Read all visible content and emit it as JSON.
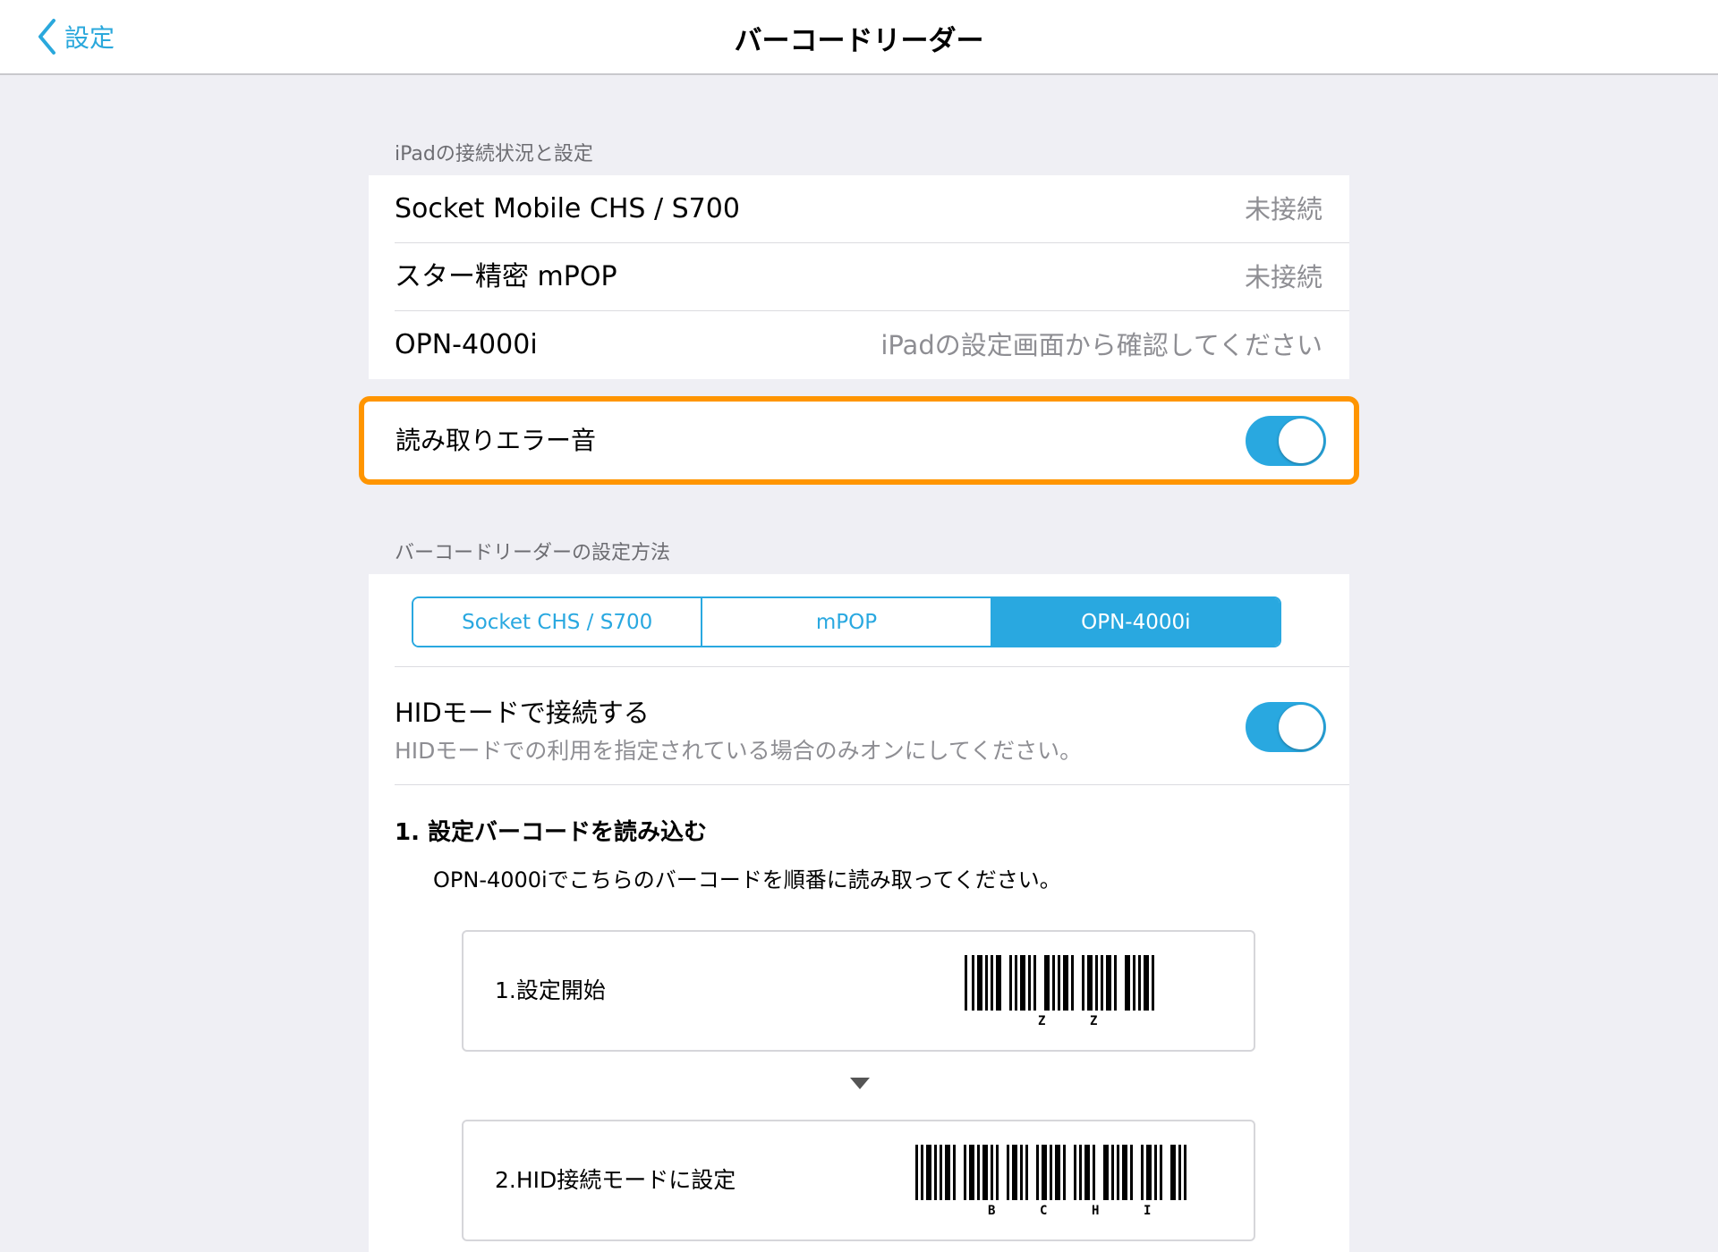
{
  "nav": {
    "back_label": "設定",
    "title": "バーコードリーダー"
  },
  "section1": {
    "header": "iPadの接続状況と設定",
    "rows": [
      {
        "title": "Socket Mobile CHS / S700",
        "value": "未接続"
      },
      {
        "title": "スター精密 mPOP",
        "value": "未接続"
      },
      {
        "title": "OPN-4000i",
        "value": "iPadの設定画面から確認してください"
      }
    ],
    "error_sound": {
      "label": "読み取りエラー音",
      "on": true
    }
  },
  "section2": {
    "header": "バーコードリーダーの設定方法",
    "segments": [
      "Socket CHS / S700",
      "mPOP",
      "OPN-4000i"
    ],
    "selected_segment": "OPN-4000i",
    "hid": {
      "title": "HIDモードで接続する",
      "subtitle": "HIDモードでの利用を指定されている場合のみオンにしてください。",
      "on": true
    },
    "step1": {
      "heading": "1. 設定バーコードを読み込む",
      "description": "OPN-4000iでこちらのバーコードを順番に読み取ってください。"
    },
    "cards": [
      {
        "label": "1.設定開始",
        "barcode_text": [
          "Z",
          "Z"
        ]
      },
      {
        "label": "2.HID接続モードに設定",
        "barcode_text": [
          "B",
          "C",
          "H",
          "I"
        ]
      }
    ]
  },
  "colors": {
    "accent": "#29a8e0",
    "highlight": "#ff9500",
    "background": "#efeff4"
  }
}
